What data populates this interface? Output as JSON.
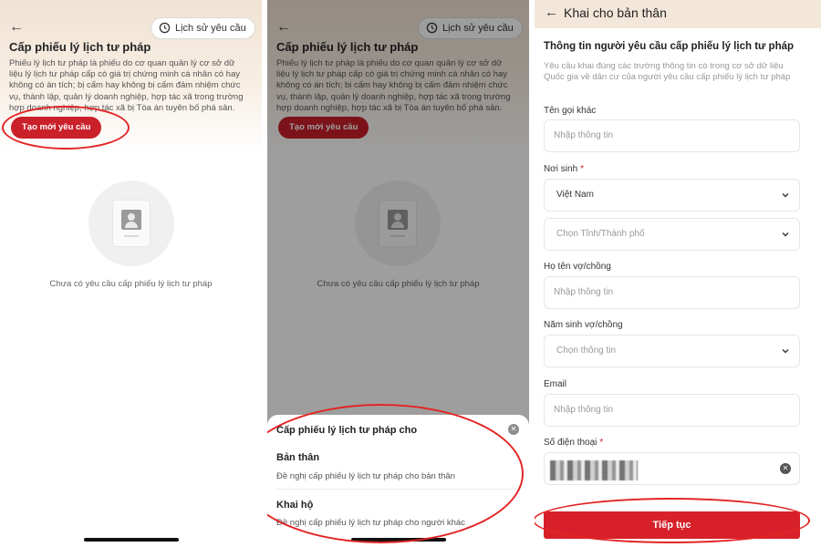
{
  "screen1": {
    "history_label": "Lịch sử yêu cầu",
    "title": "Cấp phiếu lý lịch tư pháp",
    "description": "Phiếu lý lịch tư pháp là phiếu do cơ quan quản lý cơ sở dữ liệu lý lịch tư pháp cấp có giá trị chứng minh cá nhân có hay không có án tích; bị cấm hay không bị cấm đảm nhiệm chức vụ, thành lập, quản lý doanh nghiệp, hợp tác xã trong trường hợp doanh nghiệp, hợp tác xã bị Tòa án tuyên bố phá sản.",
    "create_label": "Tạo mới yêu cầu",
    "empty_text": "Chưa có yêu cầu cấp phiếu lý lịch tư pháp"
  },
  "screen2": {
    "sheet_title": "Cấp phiếu lý lịch tư pháp cho",
    "options": [
      {
        "title": "Bản thân",
        "desc": "Đề nghị cấp phiếu lý lịch tư pháp cho bản thân"
      },
      {
        "title": "Khai hộ",
        "desc": "Đề nghị cấp phiếu lý lịch tư pháp cho người khác"
      }
    ]
  },
  "screen3": {
    "header_title": "Khai cho bản thân",
    "section_title": "Thông tin người yêu cầu cấp phiếu lý lịch tư pháp",
    "section_desc": "Yêu cầu khai đúng các trường thông tin có trong cơ sở dữ liệu Quốc gia về dân cư của người yêu cầu cấp phiếu lý lịch tư pháp",
    "fields": {
      "other_name": {
        "label": "Tên gọi khác",
        "placeholder": "Nhập thông tin"
      },
      "birthplace": {
        "label": "Nơi sinh",
        "required": "*",
        "country": "Việt Nam",
        "province_placeholder": "Chọn Tỉnh/Thành phố"
      },
      "spouse_name": {
        "label": "Họ tên vợ/chồng",
        "placeholder": "Nhập thông tin"
      },
      "spouse_birth_year": {
        "label": "Năm sinh vợ/chồng",
        "placeholder": "Chọn thông tin"
      },
      "email": {
        "label": "Email",
        "placeholder": "Nhập thông tin"
      },
      "phone": {
        "label": "Số điện thoại",
        "required": "*"
      }
    },
    "continue_label": "Tiếp tục"
  },
  "colors": {
    "accent_red": "#c9202a",
    "annotation_red": "#e32424",
    "header_beige": "#f3e7da"
  }
}
